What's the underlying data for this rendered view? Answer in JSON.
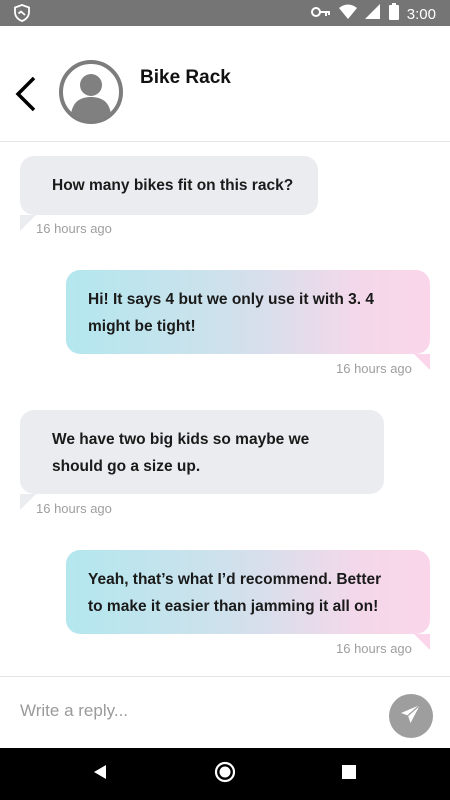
{
  "status_bar": {
    "time": "3:00",
    "icons": [
      "shield-icon",
      "key-icon",
      "wifi-icon",
      "signal-icon",
      "battery-icon"
    ]
  },
  "header": {
    "title": "Bike Rack",
    "back_icon": "back-arrow-icon",
    "avatar_icon": "person-avatar-icon"
  },
  "messages": [
    {
      "direction": "incoming",
      "text": "How many bikes fit on this rack?",
      "time": "16 hours ago"
    },
    {
      "direction": "outgoing",
      "text_line1": "Hi! It says 4 but we only use it with 3. 4",
      "text_line2": "might be tight!",
      "time": "16 hours ago"
    },
    {
      "direction": "incoming",
      "text_line1": "We have two big kids so maybe we",
      "text_line2": "should go a size up.",
      "time": "16 hours ago"
    },
    {
      "direction": "outgoing",
      "text_line1": "Yeah, that’s what I’d recommend. Better",
      "text_line2": "to make it easier than jamming it all on!",
      "time": "16 hours ago"
    }
  ],
  "reply": {
    "placeholder": "Write a reply...",
    "send_icon": "send-icon"
  },
  "colors": {
    "status_bar": "#757575",
    "incoming_bubble": "#ebecef",
    "outgoing_gradient_start": "#b3e7ee",
    "outgoing_gradient_end": "#fbd6ea",
    "send_button": "#9e9e9e"
  },
  "nav_bar": {
    "icons": [
      "back-triangle-icon",
      "home-circle-icon",
      "recents-square-icon"
    ]
  }
}
